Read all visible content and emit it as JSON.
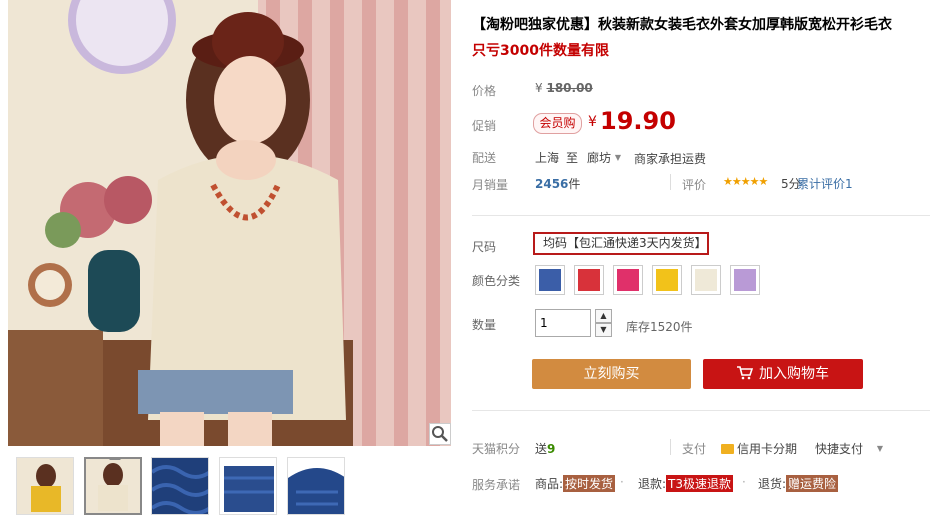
{
  "product": {
    "title": "【淘粉吧独家优惠】秋装新款女装毛衣外套女加厚韩版宽松开衫毛衣",
    "subtitle": "只亏3000件数量有限"
  },
  "price": {
    "label": "价格",
    "currency": "¥",
    "original": "180.00"
  },
  "promo": {
    "label": "促销",
    "badge": "会员购",
    "currency": "¥",
    "price": "19.90"
  },
  "shipping": {
    "label": "配送",
    "from": "上海",
    "to_word": "至",
    "to": "廊坊",
    "fee": "商家承担运费"
  },
  "sales": {
    "label": "月销量",
    "count": "2456",
    "unit": "件",
    "review_label": "评价",
    "stars": "★★★★★",
    "rating": "5分",
    "review_count": "累计评价1"
  },
  "size": {
    "label": "尺码",
    "value": "均码【包汇通快递3天内发货】"
  },
  "color": {
    "label": "颜色分类",
    "swatches": [
      "#3b5ea8",
      "#d8323a",
      "#e0306a",
      "#f2c21a",
      "#efe9d8",
      "#b99ad6"
    ]
  },
  "quantity": {
    "label": "数量",
    "value": "1",
    "stock": "库存1520件"
  },
  "actions": {
    "buy_now": "立刻购买",
    "add_cart": "加入购物车"
  },
  "points": {
    "label": "天猫积分",
    "value_prefix": "送",
    "value": "9",
    "pay_label": "支付",
    "credit": "信用卡分期",
    "quick_pay": "快捷支付"
  },
  "service": {
    "label": "服务承诺",
    "item1_prefix": "商品:",
    "item1_tag": "按时发货",
    "item2_prefix": "退款:",
    "item2_tag": "T3极速退款",
    "item3_prefix": "退货:",
    "item3_tag": "赠运费险"
  },
  "colors": {
    "accent_red": "#c40000",
    "buy_orange": "#d28b40",
    "cart_red": "#c81414"
  }
}
